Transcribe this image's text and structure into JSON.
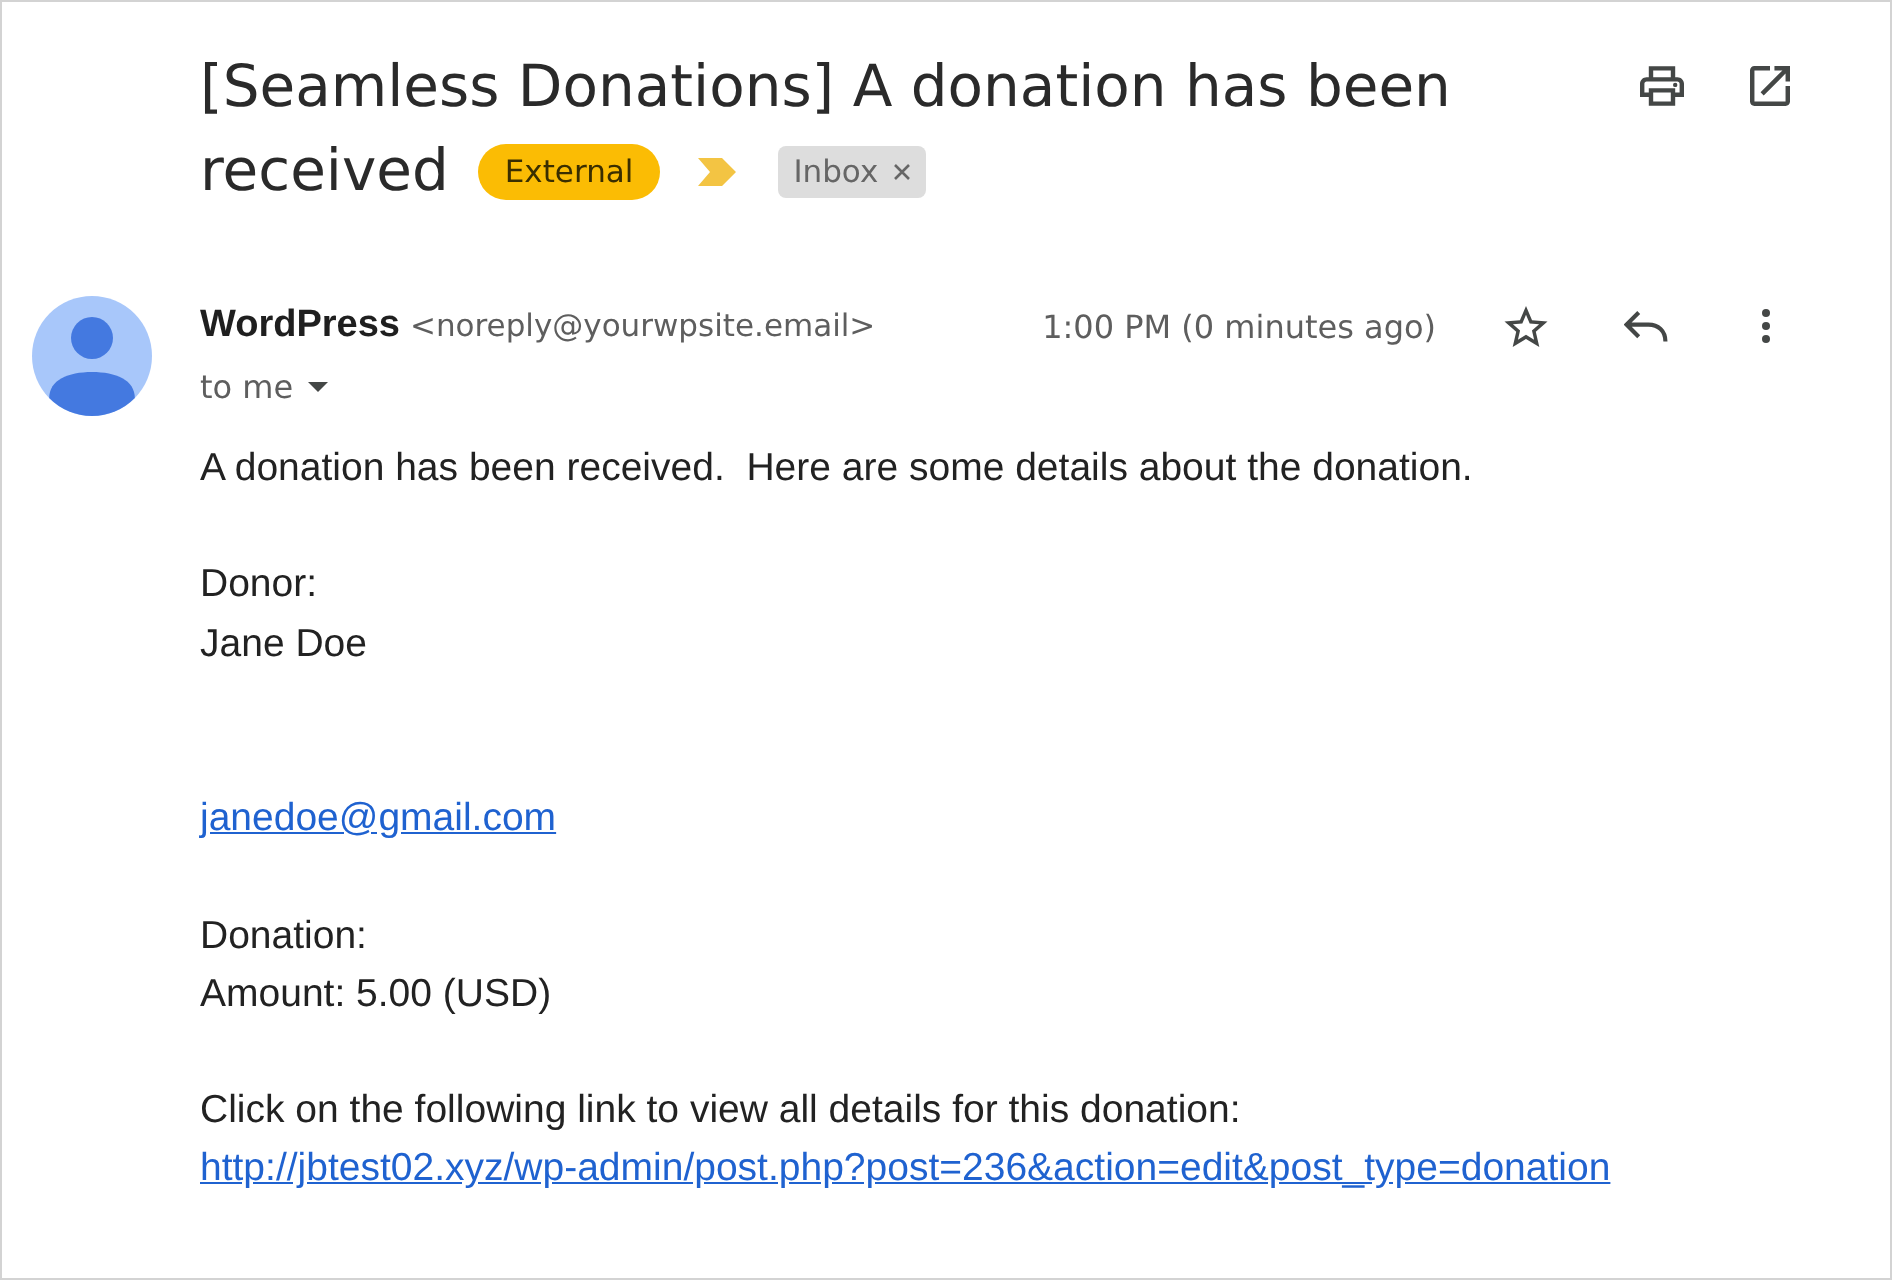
{
  "message": {
    "subject_lines": [
      "[Seamless Donations] A donation has been",
      "received"
    ],
    "labels": [
      {
        "kind": "warning",
        "text": "External"
      },
      {
        "kind": "importance"
      },
      {
        "kind": "folder",
        "text": "Inbox",
        "removable": true
      }
    ],
    "sender": {
      "name": "WordPress",
      "email": "<noreply@yourwpsite.email>",
      "time": "1:00 PM (0 minutes ago)",
      "recipient": "to me",
      "starred": false
    },
    "body": [
      {
        "kind": "text",
        "text": "A donation has been received.  Here are some details about the donation."
      },
      {
        "kind": "blank"
      },
      {
        "kind": "text",
        "text": "Donor:"
      },
      {
        "kind": "text",
        "text": "Jane Doe"
      },
      {
        "kind": "blank"
      },
      {
        "kind": "blank"
      },
      {
        "kind": "link",
        "text": "janedoe@gmail.com"
      },
      {
        "kind": "blank"
      },
      {
        "kind": "text",
        "text": "Donation:"
      },
      {
        "kind": "text",
        "text": "Amount: 5.00 (USD)"
      },
      {
        "kind": "blank"
      },
      {
        "kind": "text",
        "text": "Click on the following link to view all details for this donation:"
      },
      {
        "kind": "link",
        "text": "http://jbtest02.xyz/wp-admin/post.php?post=236&action=edit&post_type=donation"
      }
    ]
  }
}
